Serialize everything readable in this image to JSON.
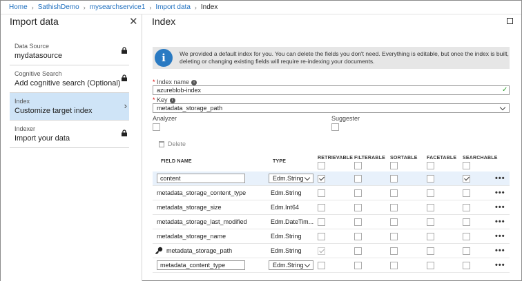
{
  "breadcrumb": {
    "items": [
      "Home",
      "SathishDemo",
      "mysearchservice1",
      "Import data",
      "Index"
    ],
    "separator": "›"
  },
  "left_panel": {
    "title": "Import data",
    "close_glyph": "✕",
    "steps": [
      {
        "label": "Data Source",
        "value": "mydatasource",
        "locked": true,
        "selected": false
      },
      {
        "label": "Cognitive Search",
        "value": "Add cognitive search (Optional)",
        "locked": true,
        "selected": false
      },
      {
        "label": "Index",
        "value": "Customize target index",
        "locked": false,
        "selected": true
      },
      {
        "label": "Indexer",
        "value": "Import your data",
        "locked": true,
        "selected": false
      }
    ]
  },
  "right_panel": {
    "title": "Index",
    "info_icon": "i",
    "info_text": "We provided a default index for you. You can delete the fields you don't need. Everything is editable, but once the index is built, deleting or changing existing fields will require re-indexing your documents.",
    "index_name": {
      "label": "Index name",
      "value": "azureblob-index",
      "valid_mark": "✓"
    },
    "key": {
      "label": "Key",
      "value": "metadata_storage_path"
    },
    "analyzer_label": "Analyzer",
    "suggester_label": "Suggester",
    "delete_label": "Delete",
    "columns": {
      "field_name": "FIELD NAME",
      "type": "TYPE",
      "retrievable": "RETRIEVABLE",
      "filterable": "FILTERABLE",
      "sortable": "SORTABLE",
      "facetable": "FACETABLE",
      "searchable": "SEARCHABLE"
    },
    "more_glyph": "•••",
    "rows": [
      {
        "name": "content",
        "type": "Edm.String",
        "editable": true,
        "key": false,
        "selected": true,
        "retrievable": true,
        "filterable": false,
        "sortable": false,
        "facetable": false,
        "searchable": true
      },
      {
        "name": "metadata_storage_content_type",
        "type": "Edm.String",
        "editable": false,
        "key": false,
        "selected": false,
        "retrievable": false,
        "filterable": false,
        "sortable": false,
        "facetable": false,
        "searchable": false
      },
      {
        "name": "metadata_storage_size",
        "type": "Edm.Int64",
        "editable": false,
        "key": false,
        "selected": false,
        "retrievable": false,
        "filterable": false,
        "sortable": false,
        "facetable": false,
        "searchable": false
      },
      {
        "name": "metadata_storage_last_modified",
        "type": "Edm.DateTim...",
        "editable": false,
        "key": false,
        "selected": false,
        "retrievable": false,
        "filterable": false,
        "sortable": false,
        "facetable": false,
        "searchable": false
      },
      {
        "name": "metadata_storage_name",
        "type": "Edm.String",
        "editable": false,
        "key": false,
        "selected": false,
        "retrievable": false,
        "filterable": false,
        "sortable": false,
        "facetable": false,
        "searchable": false
      },
      {
        "name": "metadata_storage_path",
        "type": "Edm.String",
        "editable": false,
        "key": true,
        "selected": false,
        "retrievable": true,
        "filterable": false,
        "sortable": false,
        "facetable": false,
        "searchable": false
      },
      {
        "name": "metadata_content_type",
        "type": "Edm.String",
        "editable": true,
        "key": false,
        "selected": false,
        "retrievable": false,
        "filterable": false,
        "sortable": false,
        "facetable": false,
        "searchable": false
      }
    ]
  }
}
